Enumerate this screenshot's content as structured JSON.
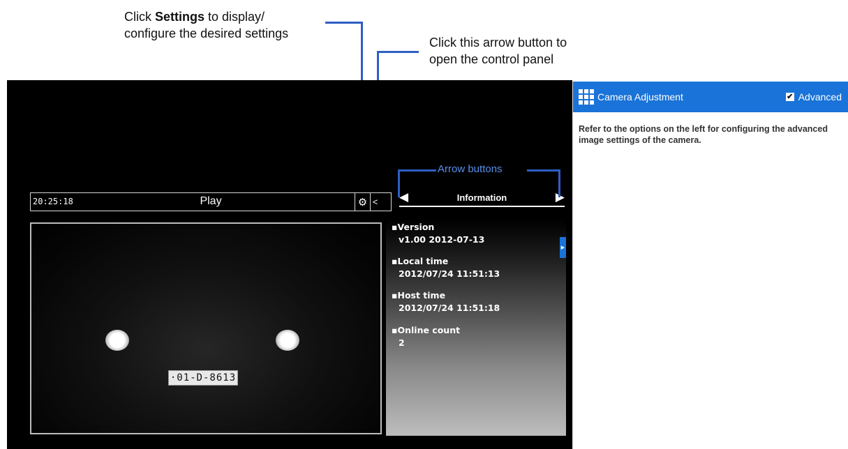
{
  "callouts": {
    "settings_prefix": "Click ",
    "settings_bold": "Settings",
    "settings_suffix": " to display/",
    "settings_line2": "configure the desired settings",
    "arrow_line1": "Click this arrow button to",
    "arrow_line2": "open the control panel",
    "arrow_buttons_label": "Arrow buttons"
  },
  "toolbar": {
    "time": "20:25:18",
    "mode": "Play",
    "settings_icon": "gear-icon",
    "open_panel_icon": "chevron-left-icon"
  },
  "video": {
    "plate_text": "·01-D-8613"
  },
  "info": {
    "title": "Information",
    "prev_arrow": "◀",
    "next_arrow": "▶",
    "items": [
      {
        "label": "Version",
        "value": "v1.00  2012-07-13"
      },
      {
        "label": "Local time",
        "value": "2012/07/24 11:51:13"
      },
      {
        "label": "Host time",
        "value": "2012/07/24 11:51:18"
      },
      {
        "label": "Online count",
        "value": "2"
      }
    ]
  },
  "control_panel": {
    "icon": "grid-icon",
    "title": "Camera Adjustment",
    "advanced_label": "Advanced",
    "advanced_checked": true,
    "description": "Refer to the options on the left for configuring the advanced image settings of the camera."
  },
  "colors": {
    "accent": "#1a73d8",
    "annotation": "#2f5ec4"
  }
}
